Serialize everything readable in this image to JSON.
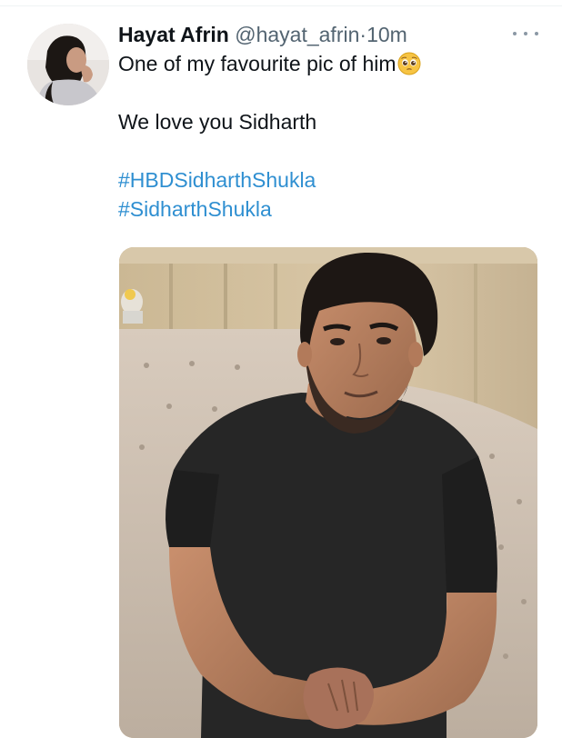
{
  "tweet": {
    "display_name": "Hayat Afrin",
    "handle": "@hayat_afrin",
    "separator": "·",
    "time": "10m",
    "lines": [
      "One of my favourite pic of him",
      "We love you Sidharth"
    ],
    "emoji": "pleading-face",
    "hashtags": [
      "#HBDSidharthShukla",
      "#SidharthShukla"
    ]
  },
  "icons": {
    "more": "more-options-icon"
  },
  "colors": {
    "text": "#0f1419",
    "secondary": "#536471",
    "link": "#2f8fd1"
  }
}
